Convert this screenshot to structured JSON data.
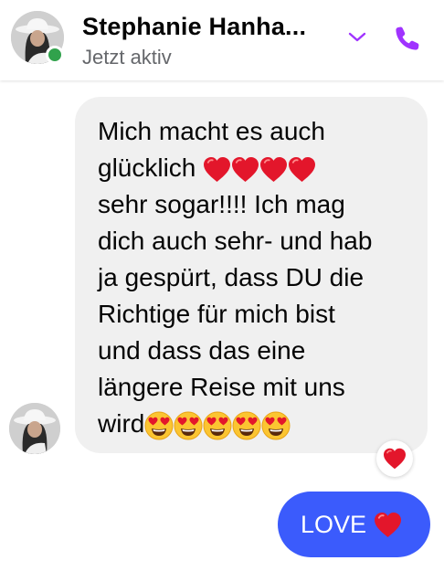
{
  "header": {
    "contact_name": "Stephanie Hanha...",
    "status": "Jetzt aktiv",
    "icons": {
      "chevron": "chevron-down-icon",
      "call": "phone-icon"
    },
    "accent_color": "#a033ff"
  },
  "messages": [
    {
      "direction": "incoming",
      "lines": [
        "Mich macht es auch",
        "glücklich",
        "sehr sogar!!!! Ich mag",
        "dich auch sehr- und hab",
        "ja gespürt, dass DU die",
        "Richtige für mich bist",
        "und dass das eine",
        "längere Reise mit uns",
        "wird"
      ],
      "inline_emojis": [
        "red-heart",
        "red-heart",
        "red-heart",
        "red-heart",
        "heart-eyes",
        "heart-eyes",
        "heart-eyes",
        "heart-eyes",
        "heart-eyes"
      ],
      "reaction": "red-heart",
      "bubble_color": "#f0f0f0"
    },
    {
      "direction": "outgoing",
      "text": "LOVE",
      "emoji": "red-heart",
      "bubble_color": "#3b5bfc"
    }
  ]
}
